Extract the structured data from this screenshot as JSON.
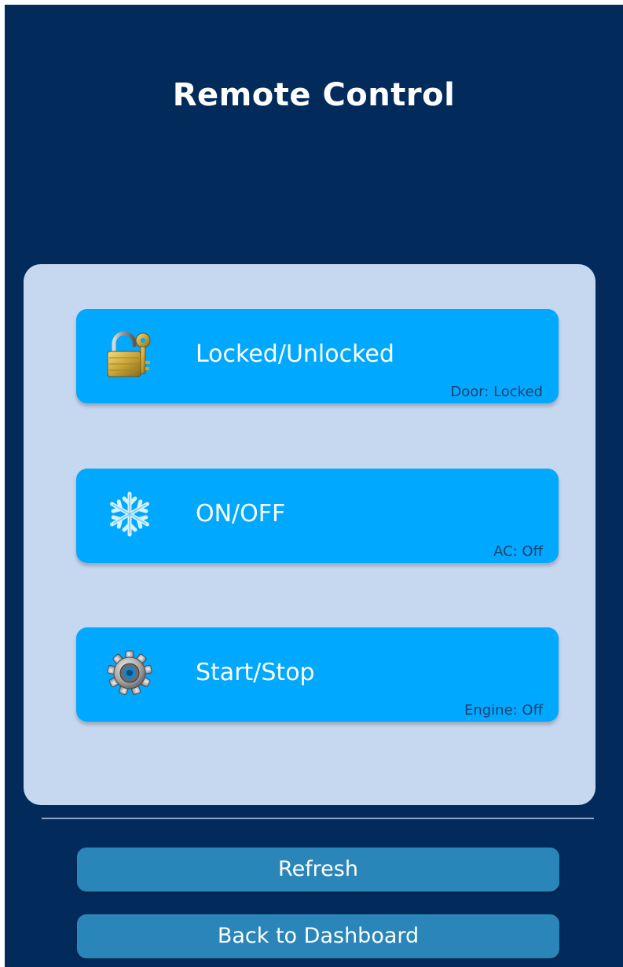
{
  "header": {
    "title": "Remote Control"
  },
  "controls": [
    {
      "label": "Locked/Unlocked",
      "status": "Door: Locked",
      "icon": "padlock-key-icon"
    },
    {
      "label": "ON/OFF",
      "status": "AC: Off",
      "icon": "snowflake-icon"
    },
    {
      "label": "Start/Stop",
      "status": "Engine: Off",
      "icon": "gear-icon"
    }
  ],
  "actions": {
    "refresh_label": "Refresh",
    "back_label": "Back to Dashboard"
  },
  "colors": {
    "background": "#022b5b",
    "panel": "#c6d8f0",
    "control_button": "#00a9ff",
    "action_button": "#2a86b8"
  }
}
